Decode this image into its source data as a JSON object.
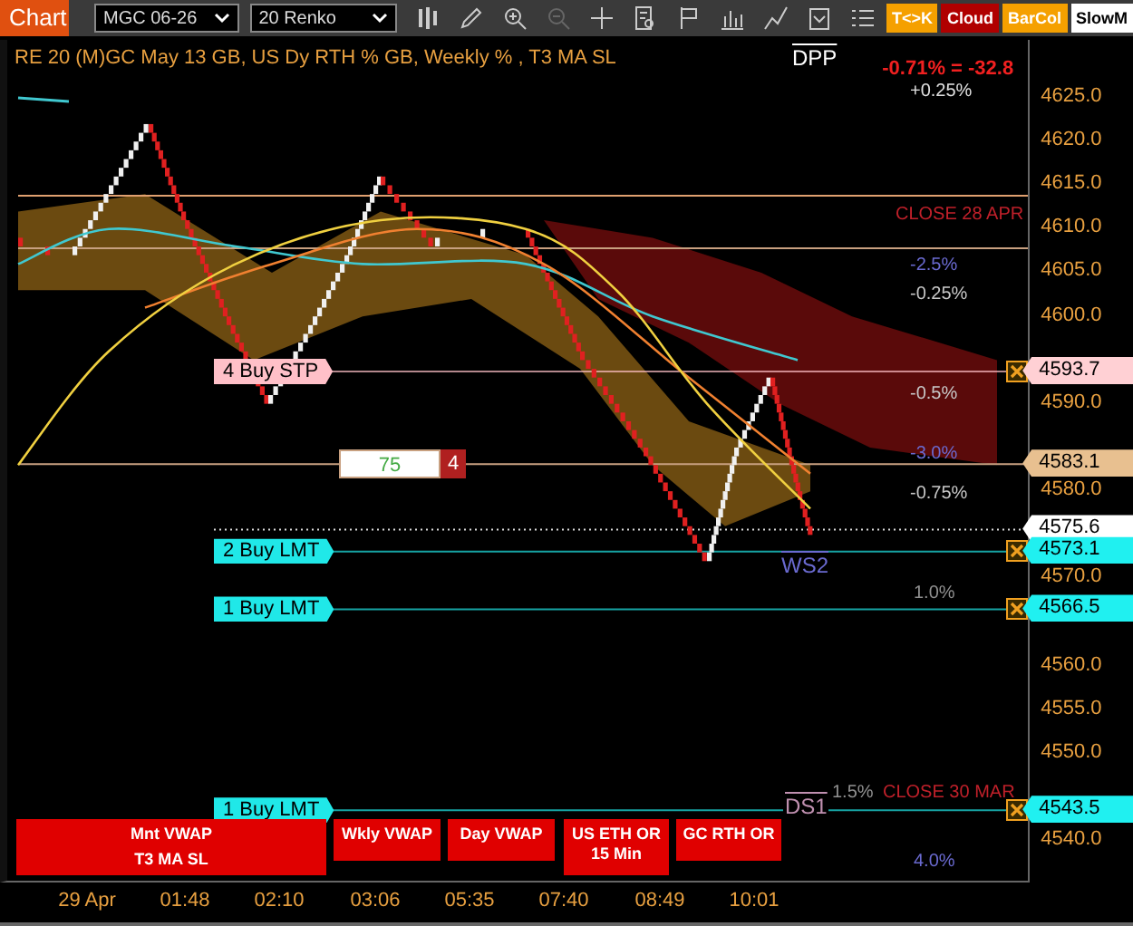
{
  "toolbar": {
    "title": "Chart",
    "instrument": "MGC 06-26",
    "bar_type": "20 Renko",
    "buttons": [
      {
        "label": "T<>K",
        "color": "#f5a000"
      },
      {
        "label": "Cloud",
        "color": "#b00000"
      },
      {
        "label": "BarCol",
        "color": "#f5a000"
      },
      {
        "label": "SlowM",
        "color": "#ffffff"
      }
    ]
  },
  "chart": {
    "header": "RE 20  (M)GC May 13 GB, US Dy RTH % GB, Weekly % , T3 MA SL",
    "pnl": "-0.71% = -32.8",
    "pivots": [
      {
        "label": "DPP"
      },
      {
        "label": "WS2"
      },
      {
        "label": "DS1"
      }
    ],
    "level_labels": [
      {
        "text": "+0.25%",
        "color": "#e0e0e0"
      },
      {
        "text": "CLOSE 28 APR",
        "color": "#c0202a"
      },
      {
        "text": "-2.5%",
        "color": "#6a6ad0"
      },
      {
        "text": "-0.25%",
        "color": "#c8c8c8"
      },
      {
        "text": "-0.5%",
        "color": "#c8c8c8"
      },
      {
        "text": "-3.0%",
        "color": "#6a6ad0"
      },
      {
        "text": "-0.75%",
        "color": "#c8c8c8"
      },
      {
        "text": "1.0%",
        "color": "#909090"
      },
      {
        "text": "1.5%",
        "color": "#909090"
      },
      {
        "text": "CLOSE 30 MAR",
        "color": "#c0202a"
      },
      {
        "text": "4.0%",
        "color": "#6a6ad0"
      }
    ],
    "orders": [
      {
        "label": "4 Buy STP",
        "color": "#ffc0c8"
      },
      {
        "label": "2 Buy LMT",
        "color": "#20e8e8"
      },
      {
        "label": "1 Buy LMT",
        "color": "#20e8e8"
      },
      {
        "label": "1 Buy LMT",
        "color": "#20e8e8"
      }
    ],
    "quantity": {
      "value": "75",
      "count": "4"
    },
    "indicators": [
      {
        "label": "Mnt VWAP",
        "sublabel": "T3 MA SL"
      },
      {
        "label": "Wkly VWAP"
      },
      {
        "label": "Day VWAP"
      },
      {
        "label": "US ETH OR 15 Min"
      },
      {
        "label": "GC RTH OR"
      }
    ],
    "axis_ticks": [
      "4625.0",
      "4620.0",
      "4615.0",
      "4610.0",
      "4605.0",
      "4600.0",
      "4590.0",
      "4580.0",
      "4570.0",
      "4560.0",
      "4555.0",
      "4550.0",
      "4540.0"
    ],
    "price_flags": [
      {
        "value": "4593.7",
        "kind": "order",
        "color": "#ffd0d4"
      },
      {
        "value": "4583.1",
        "kind": "level",
        "color": "#e8c090"
      },
      {
        "value": "4575.6",
        "kind": "last",
        "color": "#ffffff"
      },
      {
        "value": "4573.1",
        "kind": "order",
        "color": "#20f0f0"
      },
      {
        "value": "4566.5",
        "kind": "order",
        "color": "#20f0f0"
      },
      {
        "value": "4543.5",
        "kind": "order",
        "color": "#20f0f0"
      }
    ],
    "time_labels": [
      "29 Apr",
      "01:48",
      "02:10",
      "03:06",
      "05:35",
      "07:40",
      "08:49",
      "10:01"
    ]
  }
}
